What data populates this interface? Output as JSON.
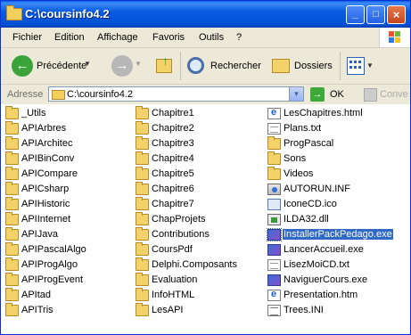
{
  "window": {
    "title": "C:\\coursinfo4.2"
  },
  "menu": [
    "Fichier",
    "Edition",
    "Affichage",
    "Favoris",
    "Outils",
    "?"
  ],
  "toolbar": {
    "back_label": "Précédente",
    "search_label": "Rechercher",
    "folders_label": "Dossiers"
  },
  "address": {
    "label": "Adresse",
    "value": "C:\\coursinfo4.2",
    "go_label": "OK",
    "convert_label": "Conve"
  },
  "files": {
    "col1": [
      {
        "name": "_Utils",
        "type": "folder"
      },
      {
        "name": "APIArbres",
        "type": "folder"
      },
      {
        "name": "APIArchitec",
        "type": "folder"
      },
      {
        "name": "APIBinConv",
        "type": "folder"
      },
      {
        "name": "APICompare",
        "type": "folder"
      },
      {
        "name": "APICsharp",
        "type": "folder"
      },
      {
        "name": "APIHistoric",
        "type": "folder"
      },
      {
        "name": "APIInternet",
        "type": "folder"
      },
      {
        "name": "APIJava",
        "type": "folder"
      },
      {
        "name": "APIPascalAlgo",
        "type": "folder"
      },
      {
        "name": "APIProgAlgo",
        "type": "folder"
      },
      {
        "name": "APIProgEvent",
        "type": "folder"
      },
      {
        "name": "APItad",
        "type": "folder"
      },
      {
        "name": "APITris",
        "type": "folder"
      }
    ],
    "col2": [
      {
        "name": "Chapitre1",
        "type": "folder"
      },
      {
        "name": "Chapitre2",
        "type": "folder"
      },
      {
        "name": "Chapitre3",
        "type": "folder"
      },
      {
        "name": "Chapitre4",
        "type": "folder"
      },
      {
        "name": "Chapitre5",
        "type": "folder"
      },
      {
        "name": "Chapitre6",
        "type": "folder"
      },
      {
        "name": "Chapitre7",
        "type": "folder"
      },
      {
        "name": "ChapProjets",
        "type": "folder"
      },
      {
        "name": "Contributions",
        "type": "folder"
      },
      {
        "name": "CoursPdf",
        "type": "folder"
      },
      {
        "name": "Delphi.Composants",
        "type": "folder"
      },
      {
        "name": "Evaluation",
        "type": "folder"
      },
      {
        "name": "InfoHTML",
        "type": "folder"
      },
      {
        "name": "LesAPI",
        "type": "folder"
      }
    ],
    "col3": [
      {
        "name": "LesChapitres.html",
        "type": "html"
      },
      {
        "name": "Plans.txt",
        "type": "doc"
      },
      {
        "name": "ProgPascal",
        "type": "folder"
      },
      {
        "name": "Sons",
        "type": "folder"
      },
      {
        "name": "Videos",
        "type": "folder"
      },
      {
        "name": "AUTORUN.INF",
        "type": "setup"
      },
      {
        "name": "IconeCD.ico",
        "type": "ico"
      },
      {
        "name": "ILDA32.dll",
        "type": "dll"
      },
      {
        "name": "InstallerPackPedago.exe",
        "type": "exe",
        "selected": true
      },
      {
        "name": "LancerAccueil.exe",
        "type": "exe"
      },
      {
        "name": "LisezMoiCD.txt",
        "type": "doc"
      },
      {
        "name": "NaviguerCours.exe",
        "type": "exe"
      },
      {
        "name": "Presentation.htm",
        "type": "html"
      },
      {
        "name": "Trees.INI",
        "type": "ini"
      }
    ]
  }
}
